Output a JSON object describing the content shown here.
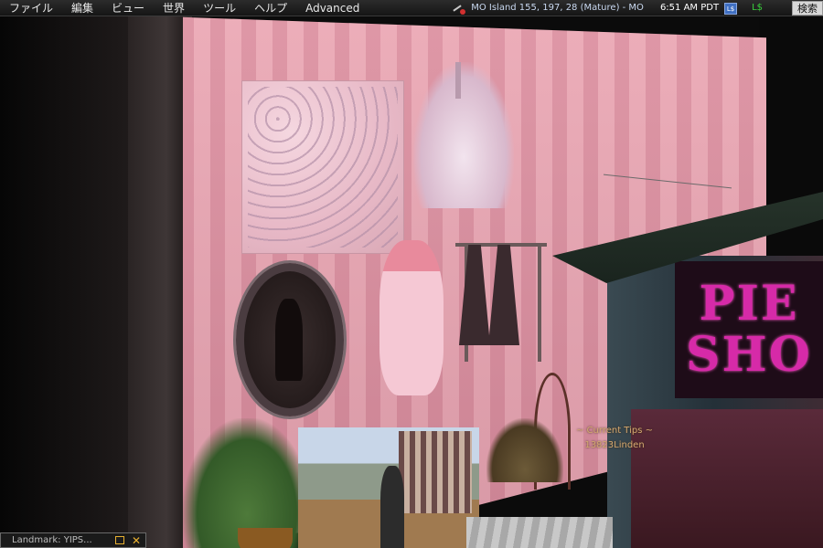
{
  "menubar": {
    "items": [
      {
        "label": "ファイル"
      },
      {
        "label": "編集"
      },
      {
        "label": "ビュー"
      },
      {
        "label": "世界"
      },
      {
        "label": "ツール"
      },
      {
        "label": "ヘルプ"
      },
      {
        "label": "Advanced"
      }
    ],
    "location": "MO Island 155, 197, 28 (Mature) - MO",
    "time": "6:51 AM PDT",
    "buy_currency_label": "L$",
    "balance": "L$",
    "search_label": "検索",
    "colors": {
      "balance": "#39d23c",
      "location": "#c9d8f0",
      "accent": "#e8b030"
    }
  },
  "world": {
    "floating_text": {
      "line1": "~ Current Tips ~",
      "line2": "13823Linden"
    },
    "sign": {
      "line1": "PIE",
      "line2": "SHO"
    }
  },
  "mini_window": {
    "title": "Landmark: YIPS..."
  }
}
